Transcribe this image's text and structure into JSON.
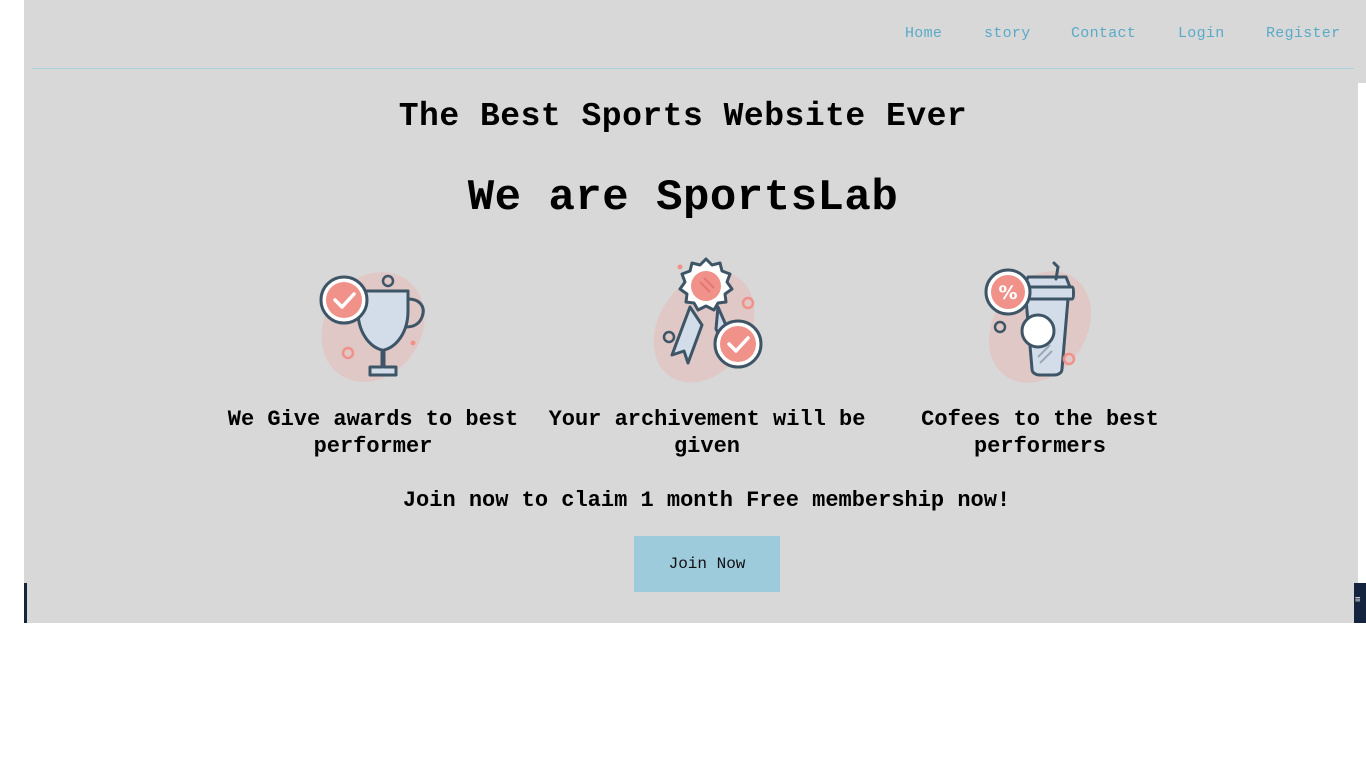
{
  "nav": {
    "items": [
      {
        "label": "Home"
      },
      {
        "label": "story"
      },
      {
        "label": "Contact"
      },
      {
        "label": "Login"
      },
      {
        "label": "Register"
      }
    ]
  },
  "hero": {
    "title": "The Best Sports Website Ever",
    "subtitle": "We are SportsLab"
  },
  "features": [
    {
      "icon": "trophy-check-icon",
      "text": "We Give awards to best performer"
    },
    {
      "icon": "award-ribbon-check-icon",
      "text": "Your archivement will be given"
    },
    {
      "icon": "coffee-cup-percent-icon",
      "text": "Cofees to the best performers"
    }
  ],
  "promo": {
    "text": "Join now to claim 1 month Free membership now!",
    "button_label": "Join Now"
  },
  "colors": {
    "panel": "#d8d8d8",
    "nav_link": "#5aaac8",
    "button": "#9ecbdc",
    "icon_accent": "#f0918a",
    "icon_stroke": "#3d5566"
  }
}
